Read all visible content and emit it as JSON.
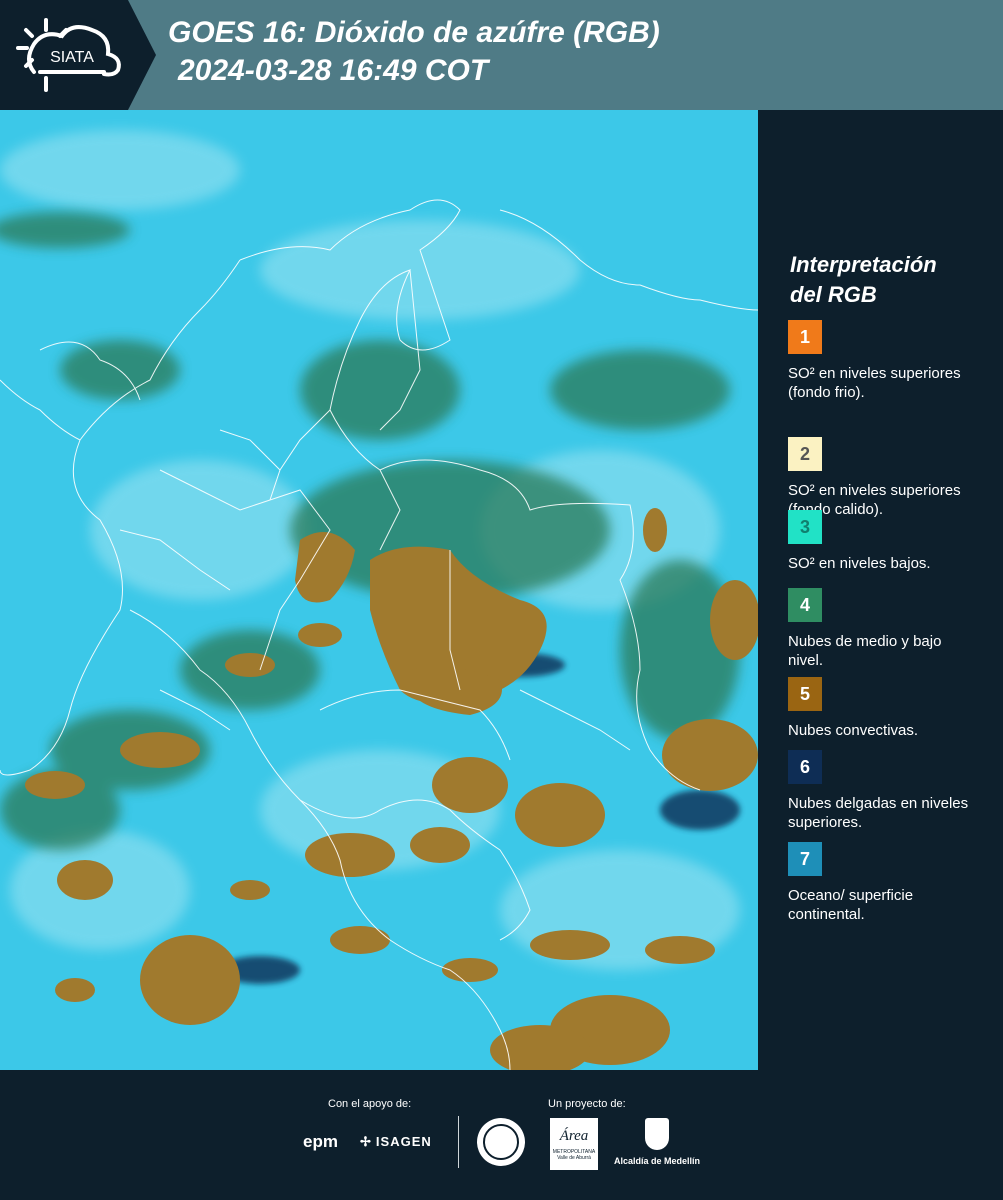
{
  "header": {
    "logo_text": "SIATA",
    "title_line1": "GOES 16: Dióxido de azúfre (RGB)",
    "title_line2": "2024-03-28 16:49 COT"
  },
  "legend": {
    "title_line1": "Interpretación",
    "title_line2": "del RGB",
    "items": [
      {
        "number": "1",
        "color": "#f07a1a",
        "text": "SO² en niveles superiores (fondo frio)."
      },
      {
        "number": "2",
        "color": "#fbf2c2",
        "text": "SO² en niveles superiores (fondo calido)."
      },
      {
        "number": "3",
        "color": "#21e2c6",
        "text": "SO² en niveles bajos."
      },
      {
        "number": "4",
        "color": "#2f8d62",
        "text": "Nubes de medio y bajo nivel."
      },
      {
        "number": "5",
        "color": "#9a6512",
        "text": "Nubes convectivas."
      },
      {
        "number": "6",
        "color": "#0e2d55",
        "text": "Nubes delgadas en niveles superiores."
      },
      {
        "number": "7",
        "color": "#1e8fb8",
        "text": "Oceano/ superficie continental."
      }
    ]
  },
  "footer": {
    "support_label": "Con el apoyo de:",
    "project_label": "Un proyecto de:",
    "logo_epm": "epm",
    "logo_isagen": "ISAGEN",
    "logo_area_main": "Área",
    "logo_area_sub": "METROPOLITANA",
    "logo_area_sub2": "Valle de Aburrá",
    "logo_alcaldia": "Alcaldía de Medellín"
  },
  "map": {
    "background_color": "#3cc8e8",
    "cloud_color": "#a07a2e",
    "border_color": "#ffffff"
  }
}
